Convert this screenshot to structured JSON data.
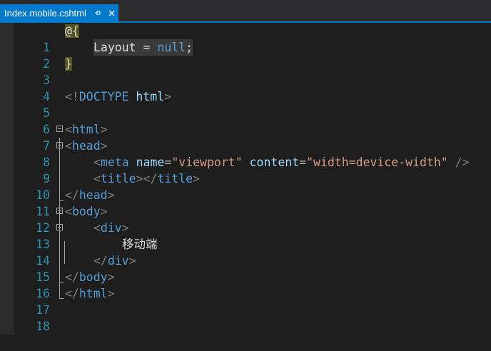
{
  "tab": {
    "title": "Index.mobile.cshtml",
    "pin_icon": "pin-icon",
    "close_icon": "close-icon"
  },
  "colors": {
    "accent": "#007acc",
    "editor_bg": "#1e1e1e",
    "line_number": "#2b91af",
    "tag": "#569cd6",
    "attribute": "#9cdcfe",
    "string": "#d69d85",
    "razor_block": "#545420"
  },
  "editor": {
    "lines": [
      {
        "n": "1",
        "a": "@{"
      },
      {
        "n": "2",
        "a": "Layout",
        "b": " = ",
        "c": "null",
        "d": ";"
      },
      {
        "n": "3",
        "a": "}"
      },
      {
        "n": "4"
      },
      {
        "n": "5",
        "a": "<!",
        "b": "DOCTYPE",
        "c": " html",
        "d": ">"
      },
      {
        "n": "6"
      },
      {
        "n": "7",
        "a": "<",
        "b": "html",
        "c": ">"
      },
      {
        "n": "8",
        "a": "<",
        "b": "head",
        "c": ">"
      },
      {
        "n": "9",
        "a": "<",
        "b": "meta",
        "c": "name",
        "d": "=",
        "e": "\"viewport\"",
        "f": "content",
        "g": "=",
        "h": "\"width=device-width\"",
        "i": " />"
      },
      {
        "n": "10",
        "a": "<",
        "b": "title",
        "c": "></",
        "d": "title",
        "e": ">"
      },
      {
        "n": "11",
        "a": "</",
        "b": "head",
        "c": ">"
      },
      {
        "n": "12",
        "a": "<",
        "b": "body",
        "c": ">"
      },
      {
        "n": "13",
        "a": "<",
        "b": "div",
        "c": ">"
      },
      {
        "n": "14",
        "a": "移动端"
      },
      {
        "n": "15",
        "a": "</",
        "b": "div",
        "c": ">"
      },
      {
        "n": "16",
        "a": "</",
        "b": "body",
        "c": ">"
      },
      {
        "n": "17",
        "a": "</",
        "b": "html",
        "c": ">"
      },
      {
        "n": "18"
      }
    ]
  }
}
